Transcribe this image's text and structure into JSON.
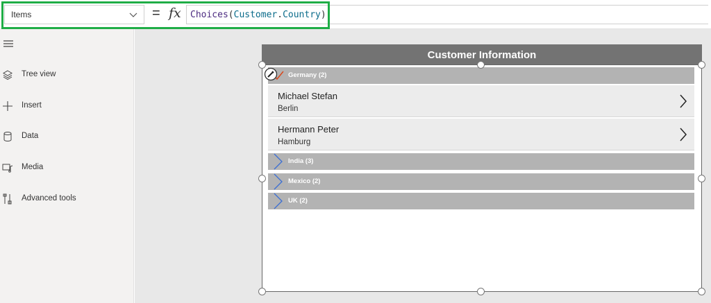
{
  "formula": {
    "property": "Items",
    "equals": "=",
    "fx": "fx",
    "tokens": [
      {
        "text": "Choices",
        "kind": "fn"
      },
      {
        "text": "(",
        "kind": "punc"
      },
      {
        "text": "Customer",
        "kind": "ref"
      },
      {
        "text": ".",
        "kind": "punc"
      },
      {
        "text": "Country",
        "kind": "ref"
      },
      {
        "text": ")",
        "kind": "punc"
      }
    ]
  },
  "sidebar": {
    "items": [
      {
        "label": "Tree view",
        "icon": "layers-icon"
      },
      {
        "label": "Insert",
        "icon": "plus-icon"
      },
      {
        "label": "Data",
        "icon": "database-icon"
      },
      {
        "label": "Media",
        "icon": "media-icon"
      },
      {
        "label": "Advanced tools",
        "icon": "tools-icon"
      }
    ]
  },
  "screen": {
    "title": "Customer Information",
    "groups": [
      {
        "label": "Germany (2)",
        "expanded": true,
        "items": [
          {
            "name": "Michael Stefan",
            "city": "Berlin"
          },
          {
            "name": "Hermann Peter",
            "city": "Hamburg"
          }
        ]
      },
      {
        "label": "India (3)",
        "expanded": false
      },
      {
        "label": "Mexico (2)",
        "expanded": false
      },
      {
        "label": "UK (2)",
        "expanded": false
      }
    ]
  },
  "colors": {
    "accent_green": "#1fad46",
    "header_gray": "#737373",
    "group_gray": "#b3b3b3",
    "chevron_blue": "#3b6fd4",
    "check_red": "#d9481c"
  }
}
